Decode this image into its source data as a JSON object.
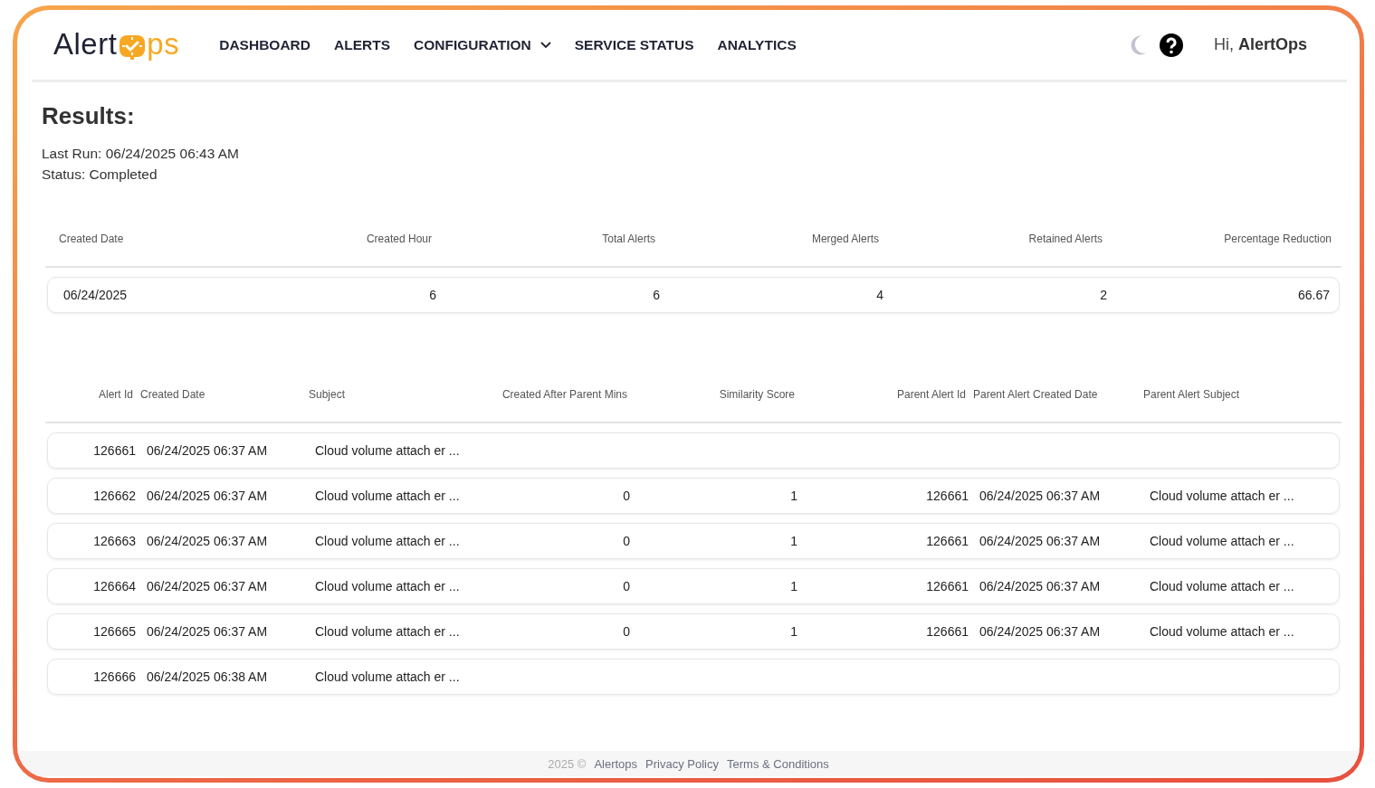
{
  "logo": {
    "text_left": "Alert",
    "text_right": "ps"
  },
  "nav": [
    {
      "label": "DASHBOARD",
      "dropdown": false
    },
    {
      "label": "ALERTS",
      "dropdown": false
    },
    {
      "label": "CONFIGURATION",
      "dropdown": true
    },
    {
      "label": "SERVICE STATUS",
      "dropdown": false
    },
    {
      "label": "ANALYTICS",
      "dropdown": false
    }
  ],
  "user": {
    "greeting": "Hi,",
    "name": "AlertOps"
  },
  "results": {
    "title": "Results:",
    "last_run": "Last Run: 06/24/2025 06:43 AM",
    "status": "Status: Completed"
  },
  "summary_table": {
    "columns": [
      "Created Date",
      "Created Hour",
      "Total Alerts",
      "Merged Alerts",
      "Retained Alerts",
      "Percentage Reduction"
    ],
    "rows": [
      [
        "06/24/2025",
        "6",
        "6",
        "4",
        "2",
        "66.67"
      ]
    ]
  },
  "alerts_table": {
    "columns": [
      "Alert Id",
      "Created Date",
      "Subject",
      "Created After Parent Mins",
      "Similarity Score",
      "Parent Alert Id",
      "Parent Alert Created Date",
      "Parent Alert Subject"
    ],
    "rows": [
      {
        "alert_id": "126661",
        "created_date": "06/24/2025 06:37 AM",
        "subject": "Cloud volume attach er ..."
      },
      {
        "alert_id": "126662",
        "created_date": "06/24/2025 06:37 AM",
        "subject": "Cloud volume attach er ...",
        "created_after_parent_mins": "0",
        "similarity_score": "1",
        "parent_alert_id": "126661",
        "parent_alert_created_date": "06/24/2025 06:37 AM",
        "parent_alert_subject": "Cloud volume attach er ..."
      },
      {
        "alert_id": "126663",
        "created_date": "06/24/2025 06:37 AM",
        "subject": "Cloud volume attach er ...",
        "created_after_parent_mins": "0",
        "similarity_score": "1",
        "parent_alert_id": "126661",
        "parent_alert_created_date": "06/24/2025 06:37 AM",
        "parent_alert_subject": "Cloud volume attach er ..."
      },
      {
        "alert_id": "126664",
        "created_date": "06/24/2025 06:37 AM",
        "subject": "Cloud volume attach er ...",
        "created_after_parent_mins": "0",
        "similarity_score": "1",
        "parent_alert_id": "126661",
        "parent_alert_created_date": "06/24/2025 06:37 AM",
        "parent_alert_subject": "Cloud volume attach er ..."
      },
      {
        "alert_id": "126665",
        "created_date": "06/24/2025 06:37 AM",
        "subject": "Cloud volume attach er ...",
        "created_after_parent_mins": "0",
        "similarity_score": "1",
        "parent_alert_id": "126661",
        "parent_alert_created_date": "06/24/2025 06:37 AM",
        "parent_alert_subject": "Cloud volume attach er ..."
      },
      {
        "alert_id": "126666",
        "created_date": "06/24/2025 06:38 AM",
        "subject": "Cloud volume attach er ..."
      }
    ]
  },
  "footer": {
    "copyright": "2025 ©",
    "links": [
      "Alertops",
      "Privacy Policy",
      "Terms & Conditions"
    ]
  }
}
